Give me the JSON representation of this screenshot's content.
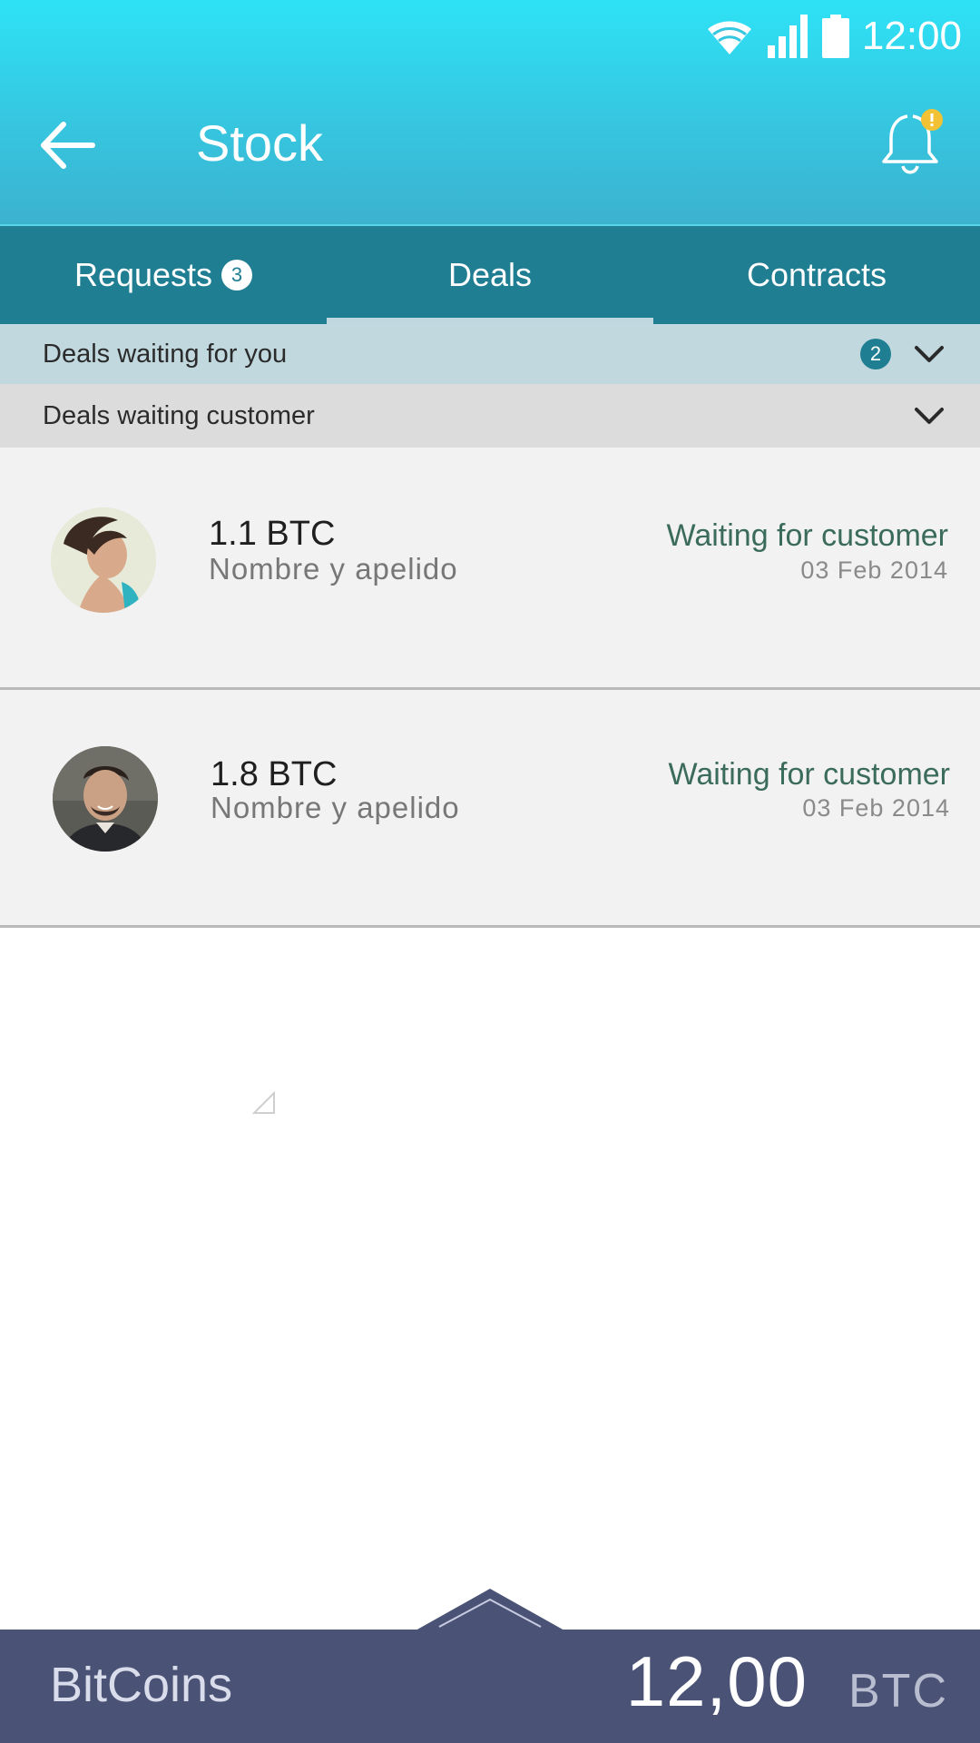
{
  "status_bar": {
    "time": "12:00"
  },
  "toolbar": {
    "title": "Stock",
    "notification_badge": "!"
  },
  "tabs": [
    {
      "label": "Requests",
      "badge": "3",
      "active": false
    },
    {
      "label": "Deals",
      "badge": "",
      "active": true
    },
    {
      "label": "Contracts",
      "badge": "",
      "active": false
    }
  ],
  "sections": [
    {
      "label": "Deals waiting for you",
      "count": "2"
    },
    {
      "label": "Deals waiting  customer",
      "count": ""
    }
  ],
  "deals": [
    {
      "amount": "1.1 BTC",
      "name": "Nombre y apelido",
      "status": "Waiting for customer",
      "date": "03 Feb 2014",
      "avatar": "woman-avatar"
    },
    {
      "amount": "1.8 BTC",
      "name": "Nombre y apelido",
      "status": "Waiting for customer",
      "date": "03 Feb 2014",
      "avatar": "man-avatar"
    }
  ],
  "bottom_bar": {
    "label": "BitCoins",
    "value": "12,00",
    "unit": "BTC"
  },
  "colors": {
    "header_top": "#2ee2f6",
    "header_bottom": "#3cb2cf",
    "tab_bar": "#207e92",
    "section_active": "#c0d8de",
    "section_inactive": "#dcdcdc",
    "status_text": "#3b6b5b",
    "bottom_bar": "#4a5275",
    "bell_badge": "#f3c234"
  }
}
